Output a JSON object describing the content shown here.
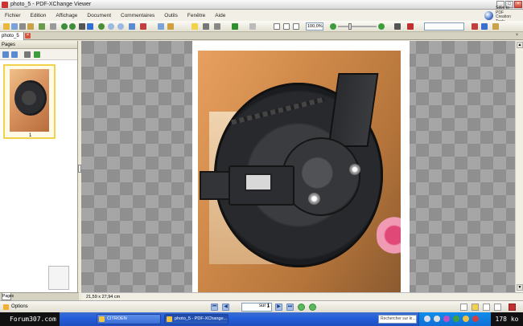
{
  "window": {
    "title": "photo_5 - PDF-XChange Viewer",
    "sponsor_text": "Save to PDF Creation Tools"
  },
  "menu": {
    "items": [
      {
        "label": "Fichier"
      },
      {
        "label": "Edition"
      },
      {
        "label": "Affichage"
      },
      {
        "label": "Document"
      },
      {
        "label": "Commentaires"
      },
      {
        "label": "Outils"
      },
      {
        "label": "Fenêtre"
      },
      {
        "label": "Aide"
      }
    ]
  },
  "toolbar": {
    "zoom_value": "100,0%",
    "zoom_level": 0.3
  },
  "tabs": {
    "document_tab": "photo_5"
  },
  "left_pane": {
    "header": "Pages",
    "thumbnail_label": "1",
    "footer_tab": "Pages"
  },
  "document": {
    "page_size": "21,59 x 27,94 cm"
  },
  "statusbar": {
    "options_label": "Options",
    "page_current": "1",
    "page_total": "sur 1"
  },
  "taskbar": {
    "start_label": "Forum307.com",
    "tasks": [
      {
        "label": "CITROEN"
      },
      {
        "label": "photo_5 - PDF-XChange..."
      }
    ],
    "language_box": "Rechercher sur le...",
    "clock": "178 ko"
  },
  "colors": {
    "accent": "#245edb",
    "thumb_highlight": "#f2d24a",
    "close_red": "#d9523a"
  }
}
